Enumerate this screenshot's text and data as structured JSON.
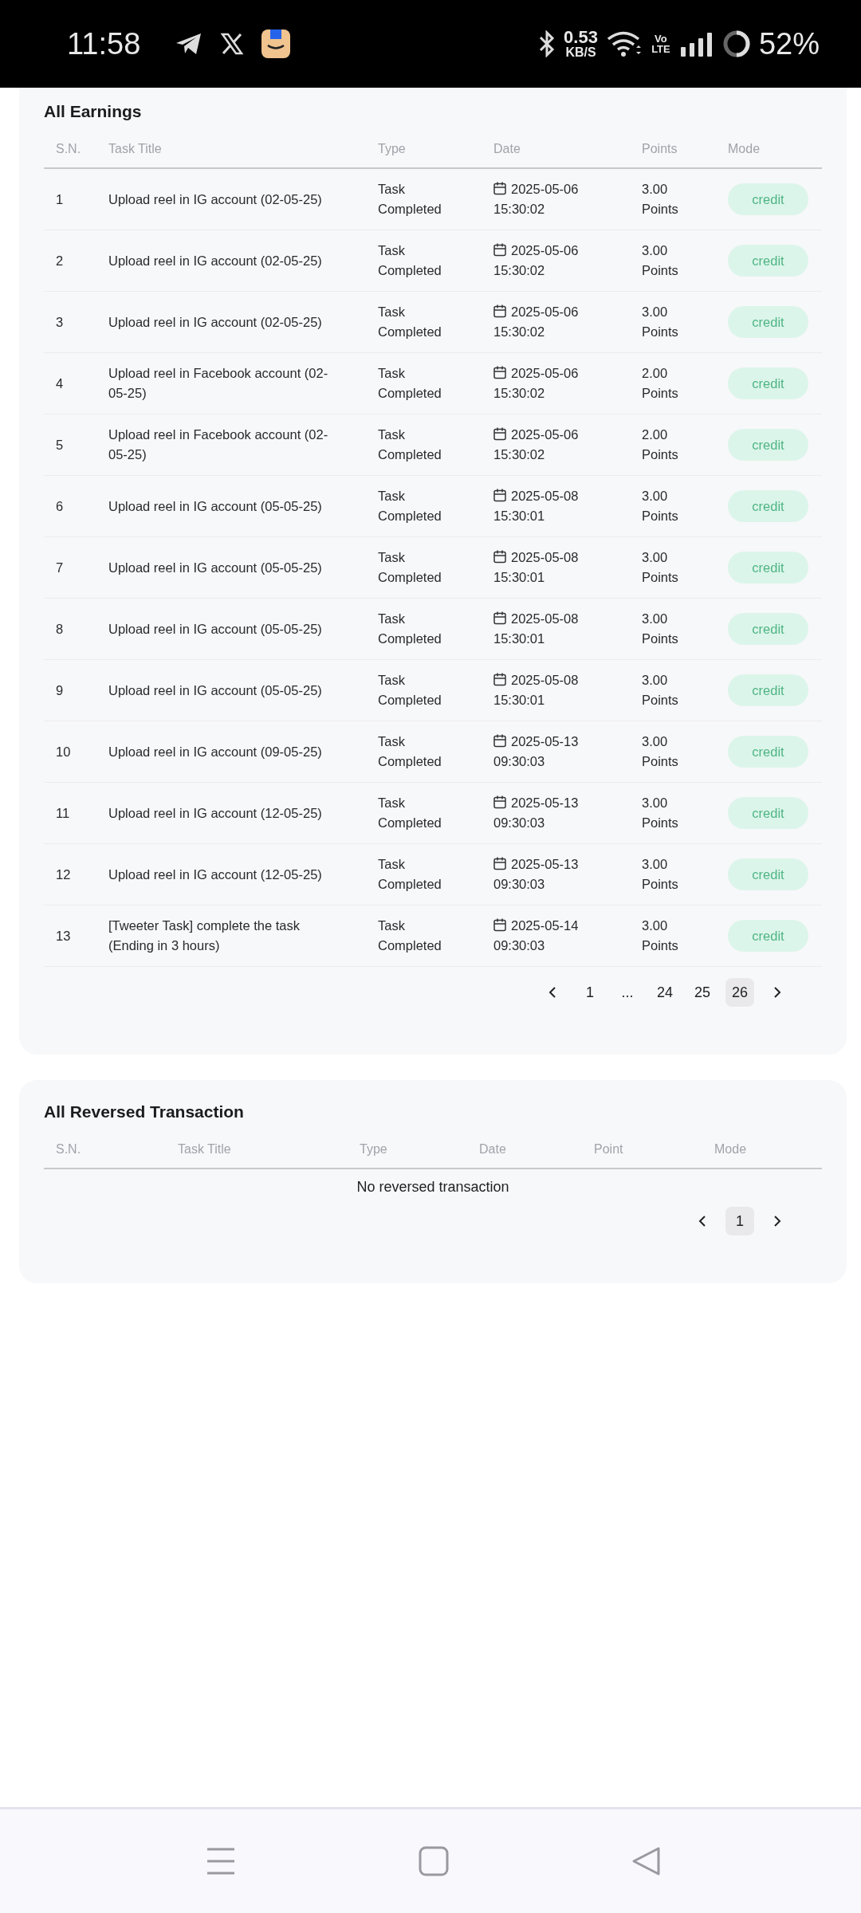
{
  "status_bar": {
    "time": "11:58",
    "speed_value": "0.53",
    "speed_unit": "KB/S",
    "network": "Vo LTE",
    "battery": "52%"
  },
  "earnings": {
    "title": "All Earnings",
    "columns": [
      "S.N.",
      "Task Title",
      "Type",
      "Date",
      "Points",
      "Mode"
    ],
    "rows": [
      {
        "sn": "1",
        "title": "Upload reel in IG account (02-05-25)",
        "type": "Task Completed",
        "date": "2025-05-06",
        "time": "15:30:02",
        "points": "3.00 Points",
        "mode": "credit"
      },
      {
        "sn": "2",
        "title": "Upload reel in IG account (02-05-25)",
        "type": "Task Completed",
        "date": "2025-05-06",
        "time": "15:30:02",
        "points": "3.00 Points",
        "mode": "credit"
      },
      {
        "sn": "3",
        "title": "Upload reel in IG account (02-05-25)",
        "type": "Task Completed",
        "date": "2025-05-06",
        "time": "15:30:02",
        "points": "3.00 Points",
        "mode": "credit"
      },
      {
        "sn": "4",
        "title": "Upload reel in Facebook account (02-05-25)",
        "type": "Task Completed",
        "date": "2025-05-06",
        "time": "15:30:02",
        "points": "2.00 Points",
        "mode": "credit"
      },
      {
        "sn": "5",
        "title": "Upload reel in Facebook account (02-05-25)",
        "type": "Task Completed",
        "date": "2025-05-06",
        "time": "15:30:02",
        "points": "2.00 Points",
        "mode": "credit"
      },
      {
        "sn": "6",
        "title": "Upload reel in IG account (05-05-25)",
        "type": "Task Completed",
        "date": "2025-05-08",
        "time": "15:30:01",
        "points": "3.00 Points",
        "mode": "credit"
      },
      {
        "sn": "7",
        "title": "Upload reel in IG account (05-05-25)",
        "type": "Task Completed",
        "date": "2025-05-08",
        "time": "15:30:01",
        "points": "3.00 Points",
        "mode": "credit"
      },
      {
        "sn": "8",
        "title": "Upload reel in IG account (05-05-25)",
        "type": "Task Completed",
        "date": "2025-05-08",
        "time": "15:30:01",
        "points": "3.00 Points",
        "mode": "credit"
      },
      {
        "sn": "9",
        "title": "Upload reel in IG account (05-05-25)",
        "type": "Task Completed",
        "date": "2025-05-08",
        "time": "15:30:01",
        "points": "3.00 Points",
        "mode": "credit"
      },
      {
        "sn": "10",
        "title": "Upload reel in IG account (09-05-25)",
        "type": "Task Completed",
        "date": "2025-05-13",
        "time": "09:30:03",
        "points": "3.00 Points",
        "mode": "credit"
      },
      {
        "sn": "11",
        "title": "Upload reel in IG account (12-05-25)",
        "type": "Task Completed",
        "date": "2025-05-13",
        "time": "09:30:03",
        "points": "3.00 Points",
        "mode": "credit"
      },
      {
        "sn": "12",
        "title": "Upload reel in IG account (12-05-25)",
        "type": "Task Completed",
        "date": "2025-05-13",
        "time": "09:30:03",
        "points": "3.00 Points",
        "mode": "credit"
      },
      {
        "sn": "13",
        "title": "[Tweeter Task] complete the task (Ending in 3 hours)",
        "type": "Task Completed",
        "date": "2025-05-14",
        "time": "09:30:03",
        "points": "3.00 Points",
        "mode": "credit"
      }
    ],
    "pagination": [
      {
        "kind": "prev"
      },
      {
        "kind": "page",
        "label": "1",
        "selected": false
      },
      {
        "kind": "ellipsis",
        "label": "..."
      },
      {
        "kind": "page",
        "label": "24",
        "selected": false
      },
      {
        "kind": "page",
        "label": "25",
        "selected": false
      },
      {
        "kind": "page",
        "label": "26",
        "selected": true
      },
      {
        "kind": "next"
      }
    ]
  },
  "reversed": {
    "title": "All Reversed Transaction",
    "columns": [
      "S.N.",
      "Task Title",
      "Type",
      "Date",
      "Point",
      "Mode"
    ],
    "empty_message": "No reversed transaction",
    "pagination": [
      {
        "kind": "prev"
      },
      {
        "kind": "page",
        "label": "1",
        "selected": true
      },
      {
        "kind": "next"
      }
    ]
  }
}
